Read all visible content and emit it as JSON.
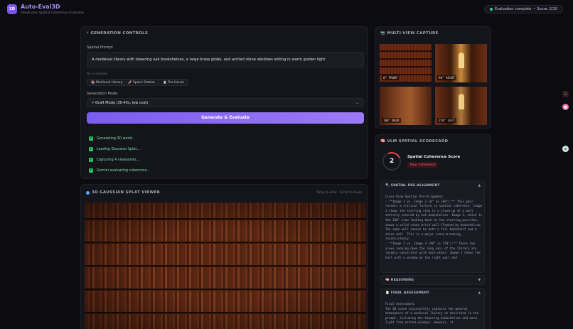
{
  "header": {
    "logo_text": "3D",
    "title": "Auto-Eval3D",
    "subtitle": "Viewfusion Spatial Coherence Evaluator",
    "status": "Evaluation complete — Score: 2/10"
  },
  "controls": {
    "section_title": "⚡ GENERATION CONTROLS",
    "prompt_label": "Spatial Prompt",
    "prompt_value": "A medieval library with towering oak bookshelves, a large brass globe, and arched stone windows letting in warm golden light",
    "samples_label": "Try a sample:",
    "samples": [
      "📚 Medieval Library",
      "🚀 Space Station",
      "🍵 Tea House"
    ],
    "mode_label": "Generation Mode",
    "mode_value": "⚡ Draft Mode (30-45s, low cost)",
    "generate_label": "Generate & Evaluate",
    "steps": [
      "Generating 3D world...",
      "Loading Gaussian Splat...",
      "Capturing 4 viewpoints...",
      "Gemini evaluating coherence..."
    ]
  },
  "viewer": {
    "title": "3D GAUSSIAN SPLAT VIEWER",
    "hint": "Drag to orbit · Scroll to zoom"
  },
  "multiview": {
    "title": "📷 MULTI-VIEW CAPTURE",
    "views": [
      "0° FRONT",
      "90° RIGHT",
      "180° BACK",
      "270° LEFT"
    ]
  },
  "scorecard": {
    "title": "🧠 VLM SPATIAL SCORECARD",
    "score": "2",
    "score_fraction": 0.2,
    "score_title": "Spatial Coherence Score",
    "badge": "Poor Coherence",
    "sections": [
      {
        "title": "🔍 SPATIAL PRE-ALIGNMENT",
        "chevron": "▲",
        "body": "Cross-View Spatial Pre-Alignment:\n- **Image 1 vs. Image 3 (0° vs 180°):** This pair reveals a critical failure in spatial coherence. Image 1 shows the starting view is a close-up of a wall entirely covered by oak bookshelves. Image 3, which is the 180° view looking back at the starting position, shows a solid stone brick wall flanked by bookshelves. The same wall cannot be both a full bookshelf and a stone wall. This is a major scene-breaking inconsistency.\n- **Image 2 vs. Image 4 (90° vs 270°):** These two views looking down the long axis of the library are largely consistent with each other. Image 2 shows the hall with a window on the right wall and"
      },
      {
        "title": "🧠 REASONING",
        "chevron": "▼",
        "body": ""
      },
      {
        "title": "📋 FINAL ASSESSMENT",
        "chevron": "▲",
        "body": "Final Assessment:\nThe 3D scene successfully captures the general atmosphere of a medieval library as described in the prompt, including the towering bookshelves and warm light from arched windows. However, it"
      }
    ]
  },
  "colors": {
    "accent": "#8b5cf6",
    "success": "#22c55e",
    "danger": "#ef4444"
  }
}
